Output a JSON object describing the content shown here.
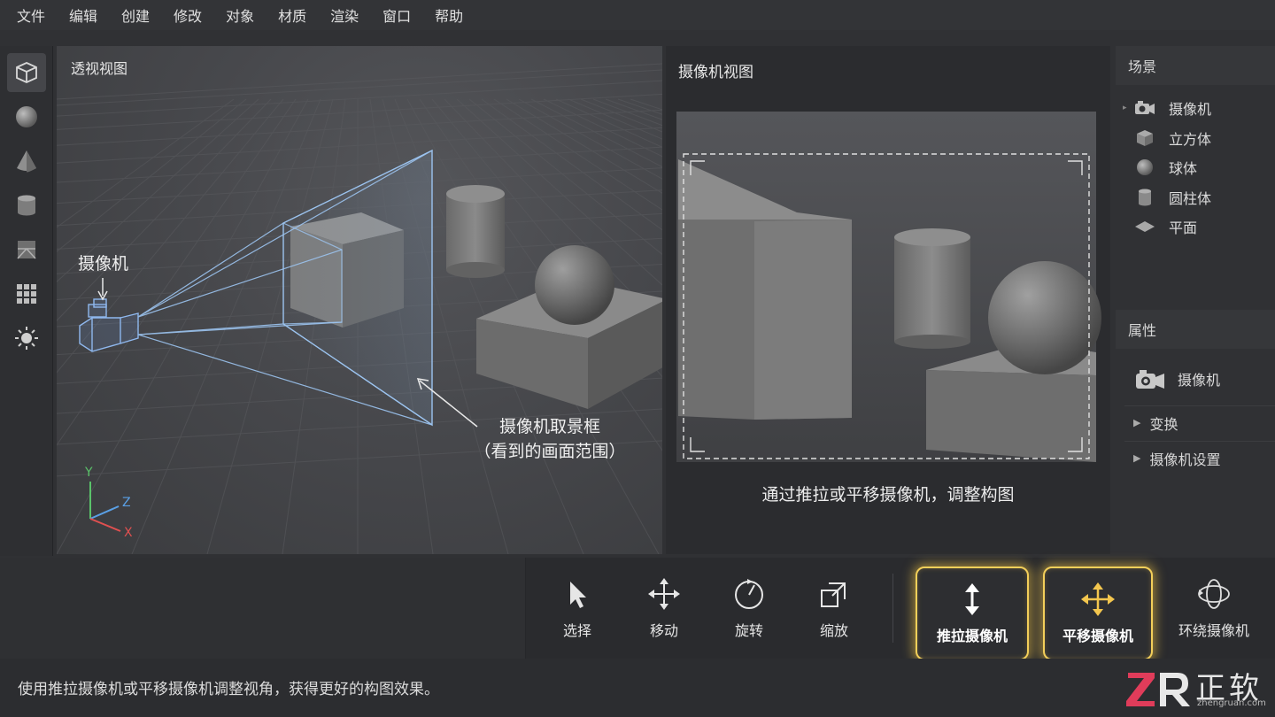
{
  "menu": [
    "文件",
    "编辑",
    "创建",
    "修改",
    "对象",
    "材质",
    "渲染",
    "窗口",
    "帮助"
  ],
  "left_toolbar": [
    "cube-icon",
    "sphere-icon",
    "cone-icon",
    "cylinder-icon",
    "plane-icon",
    "grid-icon",
    "light-icon"
  ],
  "perspective_view": {
    "title": "透视视图",
    "camera_label": "摄像机",
    "frustum_label_line1": "摄像机取景框",
    "frustum_label_line2": "（看到的画面范围）",
    "axis_x": "X",
    "axis_y": "Y",
    "axis_z": "Z"
  },
  "camera_view": {
    "title": "摄像机视图",
    "caption": "通过推拉或平移摄像机，调整构图"
  },
  "scene_panel": {
    "title": "场景",
    "items": [
      {
        "label": "摄像机",
        "icon": "camera-icon"
      },
      {
        "label": "立方体",
        "icon": "cube-icon"
      },
      {
        "label": "球体",
        "icon": "sphere-icon"
      },
      {
        "label": "圆柱体",
        "icon": "cylinder-icon"
      },
      {
        "label": "平面",
        "icon": "plane-icon"
      }
    ]
  },
  "properties_panel": {
    "title": "属性",
    "object": "摄像机",
    "sections": [
      "变换",
      "摄像机设置"
    ]
  },
  "bottom_tools": [
    {
      "label": "选择",
      "icon": "cursor-icon"
    },
    {
      "label": "移动",
      "icon": "move-icon"
    },
    {
      "label": "旋转",
      "icon": "rotate-icon"
    },
    {
      "label": "缩放",
      "icon": "scale-icon"
    },
    {
      "label": "推拉摄像机",
      "icon": "dolly-icon",
      "highlighted": true
    },
    {
      "label": "平移摄像机",
      "icon": "pan-icon",
      "highlighted": true
    },
    {
      "label": "环绕摄像机",
      "icon": "orbit-icon"
    }
  ],
  "status": "使用推拉摄像机或平移摄像机调整视角，获得更好的构图效果。",
  "brand": {
    "logo": "ZR",
    "name": "正软",
    "url": "zhengruan.com"
  },
  "colors": {
    "highlight": "#f3cf5a",
    "frustum": "#9cc4f0",
    "brand_red": "#e03c5a"
  }
}
